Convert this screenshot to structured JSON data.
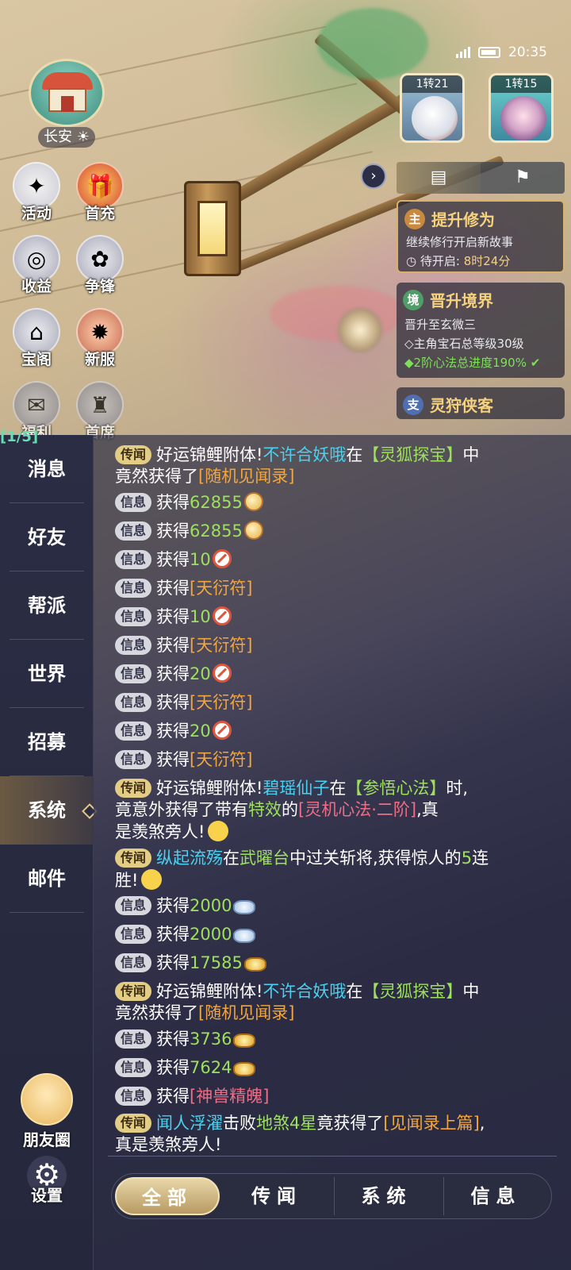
{
  "status_bar": {
    "time": "20:35"
  },
  "location": {
    "name": "长安"
  },
  "left_menu": [
    {
      "label": "活动",
      "icon": "event-icon"
    },
    {
      "label": "首充",
      "icon": "gift-box-icon"
    },
    {
      "label": "收益",
      "icon": "earnings-icon"
    },
    {
      "label": "争锋",
      "icon": "paw-icon"
    },
    {
      "label": "宝阁",
      "icon": "pavilion-icon"
    },
    {
      "label": "新服",
      "icon": "new-server-icon"
    },
    {
      "label": "福利",
      "icon": "welfare-icon"
    },
    {
      "label": "首席",
      "icon": "chief-icon"
    }
  ],
  "party": [
    {
      "level": "1转21",
      "role": "pet"
    },
    {
      "level": "1转15",
      "role": "player"
    }
  ],
  "quest_tracker": {
    "tabs": [
      "quest-scroll-icon",
      "flag-icon"
    ],
    "main_quest": {
      "tag": "主",
      "title": "提升修为",
      "desc": "继续修行开启新故事",
      "timer_label": "待开启:",
      "timer_value": "8时24分"
    },
    "realm_quest": {
      "tag": "境",
      "title": "晋升境界",
      "desc": "晋升至玄微三",
      "req1": "◇主角宝石总等级30级",
      "req2": "◆2阶心法总进度190%"
    },
    "next_quest": {
      "tag": "支",
      "title": "灵狩侠客"
    }
  },
  "chat": {
    "partial_indicator": "[1/5]",
    "channels": [
      "消息",
      "好友",
      "帮派",
      "世界",
      "招募",
      "系统",
      "邮件"
    ],
    "active_channel": "系统",
    "moments_label": "朋友圈",
    "settings_label": "设置",
    "bottom_tabs": [
      "全部",
      "传闻",
      "系统",
      "信息"
    ],
    "badges": {
      "rumor": "传闻",
      "info": "信息"
    },
    "messages": {
      "m1": {
        "a": "好运锦鲤附体!",
        "b": "不许合妖哦",
        "c": "在",
        "d": "【灵狐探宝】",
        "e": "中",
        "f": "竟然获得了",
        "g": "[随机见闻录]"
      },
      "get": "获得",
      "v62855a": "62855",
      "v62855b": "62855",
      "v10a": "10",
      "item_tyf": "[天衍符]",
      "v10b": "10",
      "v20a": "20",
      "v20b": "20",
      "m2": {
        "a": "好运锦鲤附体!",
        "b": "碧瑶仙子",
        "c": "在",
        "d": "【参悟心法】",
        "e": "时,",
        "f": "竟意外获得了带有",
        "g": "特效",
        "h": "的",
        "i": "[灵机心法·二阶]",
        "j": ",真",
        "k": "是羡煞旁人!"
      },
      "m3": {
        "a": "纵起流殇",
        "b": "在",
        "c": "武曜台",
        "d": "中过关斩将,获得惊人的",
        "e": "5",
        "f": "连",
        "g": "胜!"
      },
      "v2000a": "2000",
      "v2000b": "2000",
      "v17585": "17585",
      "m4": {
        "a": "好运锦鲤附体!",
        "b": "不许合妖哦",
        "c": "在",
        "d": "【灵狐探宝】",
        "e": "中",
        "f": "竟然获得了",
        "g": "[随机见闻录]"
      },
      "v3736": "3736",
      "v7624": "7624",
      "item_sspp": "[神兽精魄]",
      "m5": {
        "a": "闻人浮濯",
        "b": "击败",
        "c": "地煞4星",
        "d": "竟获得了",
        "e": "[见闻录上篇]",
        "f": ",",
        "g": "真是羡煞旁人!"
      }
    }
  },
  "colors": {
    "rumor_badge": "#e3cc83",
    "info_badge": "#d7d8de",
    "item_orange": "#f2a640",
    "player_blue": "#4ad1f0",
    "highlight_green": "#9de05c",
    "item_red": "#f06d86"
  }
}
